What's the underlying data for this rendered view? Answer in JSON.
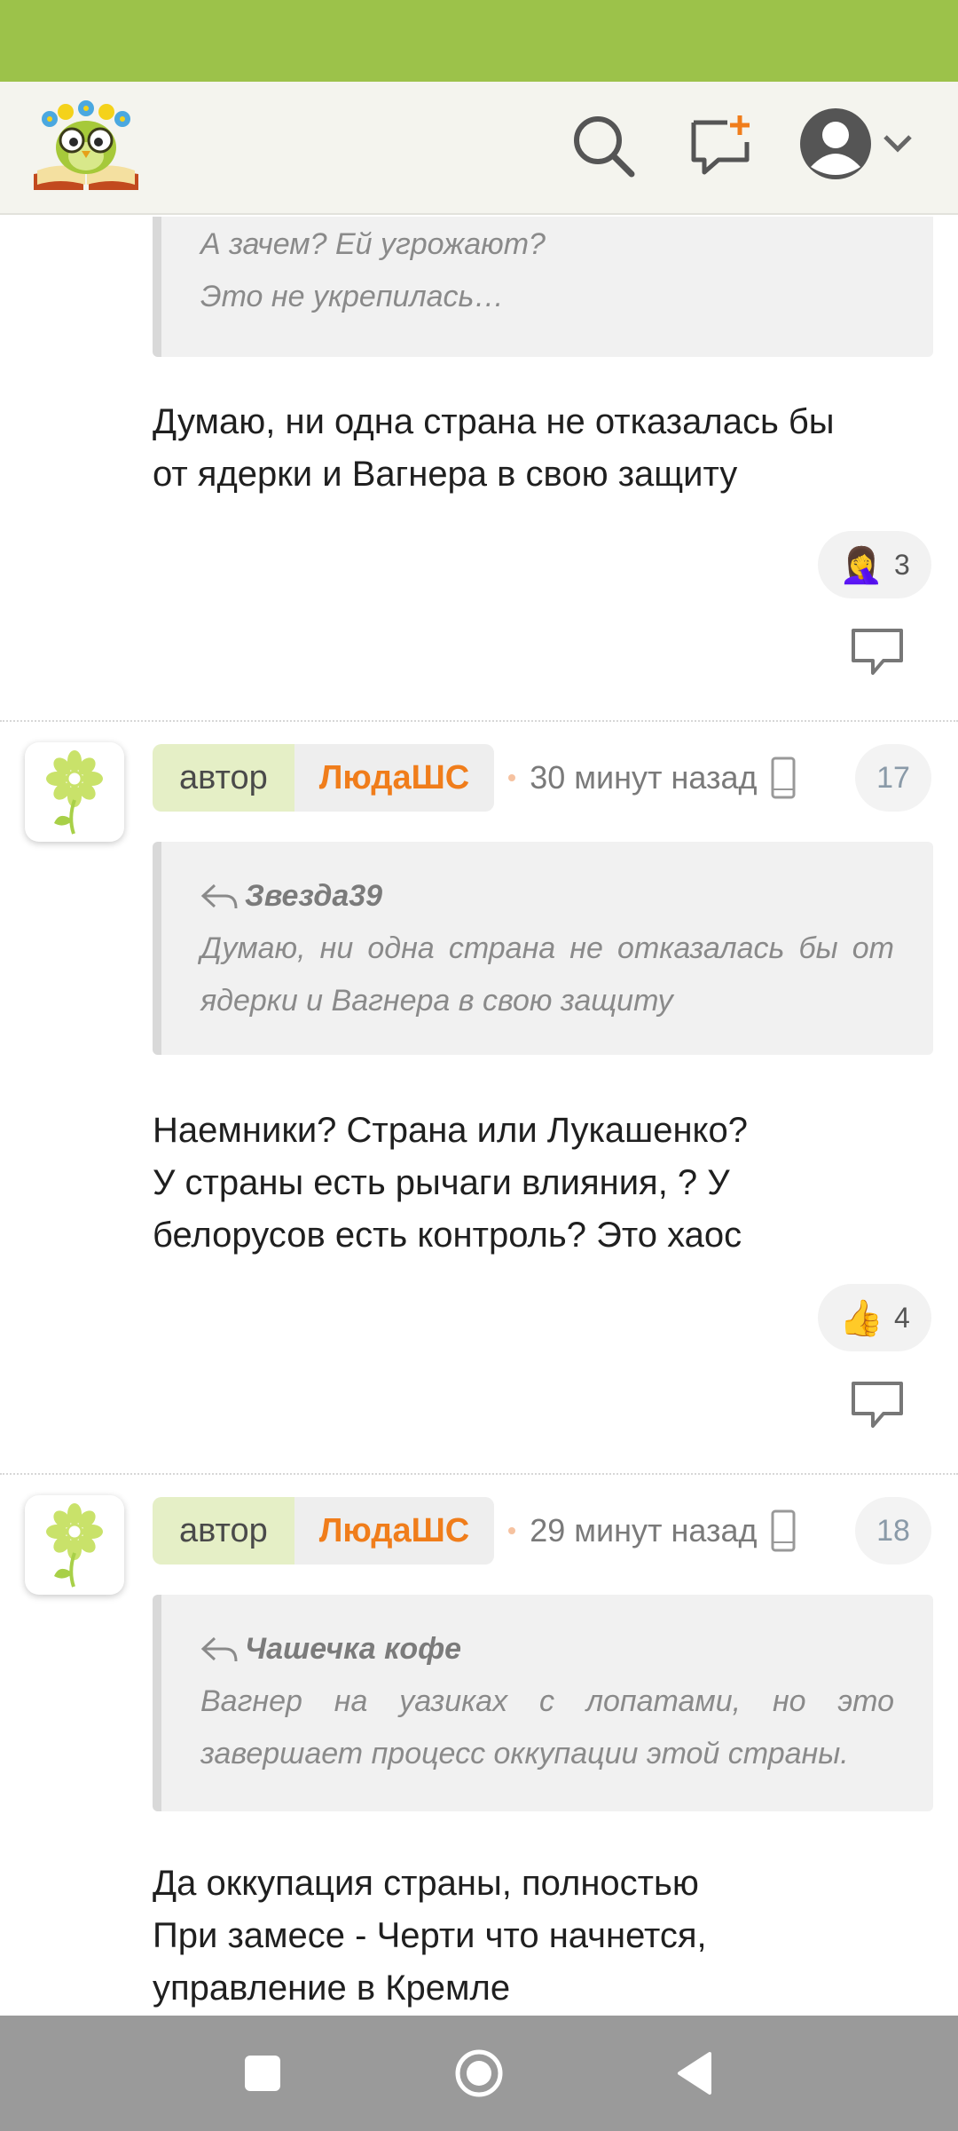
{
  "colors": {
    "status_bar": "#9cc24a",
    "header_bg": "#f4f4ee",
    "author_name": "#f07d1b",
    "author_role_bg": "#e5efc6",
    "nav_bar": "#9a9a9a"
  },
  "header": {
    "logo": "owl-book-logo",
    "icons": [
      "search-icon",
      "new-message-icon",
      "profile-avatar-icon",
      "chevron-down-icon"
    ]
  },
  "comments": [
    {
      "quote": {
        "lines": [
          "А зачем? Ей угрожают?",
          "Это не укрепилась…"
        ]
      },
      "text_lines": [
        "Думаю, ни одна страна не отказалась бы",
        "от ядерки и Вагнера в свою защиту"
      ],
      "reaction": {
        "emoji": "🤦‍♀️",
        "count": "3"
      }
    },
    {
      "role": "автор",
      "author": "ЛюдаШС",
      "time": "30 минут назад",
      "number": "17",
      "quote": {
        "author": "Звезда39",
        "text": "Думаю, ни одна страна не отказалась бы от ядерки и Вагнера в свою защиту"
      },
      "text_lines": [
        "Наемники? Страна или Лукашенко?",
        "У страны есть рычаги влияния, ? У",
        "белорусов есть контроль? Это хаос"
      ],
      "reaction": {
        "emoji": "👍",
        "count": "4"
      }
    },
    {
      "role": "автор",
      "author": "ЛюдаШС",
      "time": "29 минут назад",
      "number": "18",
      "quote": {
        "author": "Чашечка кофе",
        "text": "Вагнер на уазиках с лопатами, но это завершает процесс оккупации этой страны."
      },
      "text_lines": [
        "Да оккупация страны, полностью",
        "При замесе - Черти что начнется,",
        "управление в Кремле"
      ]
    }
  ],
  "nav": {
    "buttons": [
      "recent-apps-icon",
      "home-icon",
      "back-icon"
    ]
  }
}
